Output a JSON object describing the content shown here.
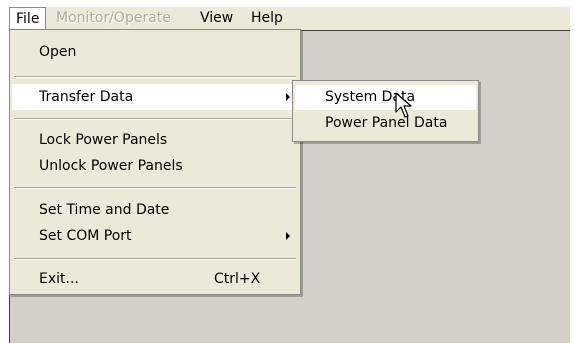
{
  "menubar": {
    "items": [
      {
        "label": "File",
        "state": "active"
      },
      {
        "label": "Monitor/Operate",
        "state": "disabled"
      },
      {
        "label": "View",
        "state": "normal"
      },
      {
        "label": "Help",
        "state": "normal"
      }
    ]
  },
  "file_menu": {
    "open": "Open",
    "transfer_data": "Transfer Data",
    "lock_power_panels": "Lock Power Panels",
    "unlock_power_panels": "Unlock Power Panels",
    "set_time_and_date": "Set Time and Date",
    "set_com_port": "Set COM Port",
    "exit": "Exit...",
    "exit_shortcut": "Ctrl+X"
  },
  "transfer_submenu": {
    "system_data": "System Data",
    "power_panel_data": "Power Panel Data",
    "highlighted": "System Data"
  },
  "colors": {
    "menu_background": "#ece9d8",
    "client_background": "#d4d0c8",
    "disabled_text": "#adaaa0",
    "highlight_background": "#ffffff"
  },
  "icons": [
    "submenu-arrow-icon",
    "mouse-pointer-icon"
  ]
}
